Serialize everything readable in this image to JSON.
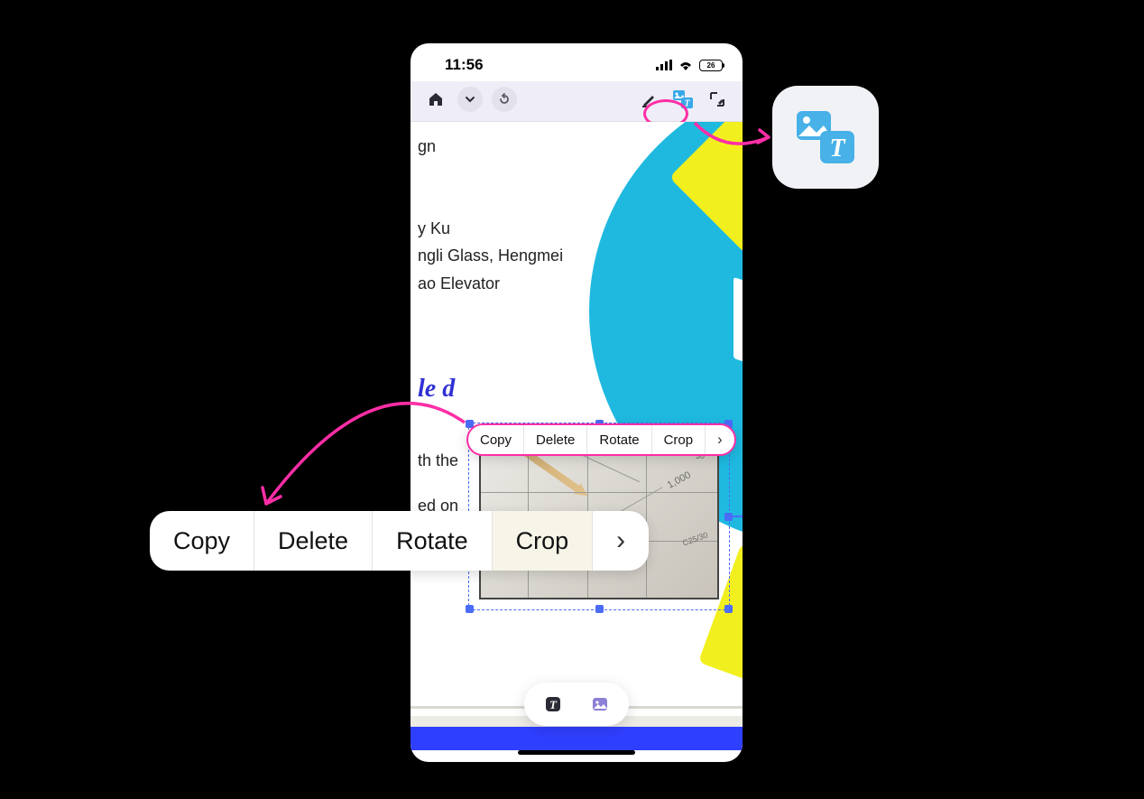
{
  "status_bar": {
    "time": "11:56",
    "battery_level": "26"
  },
  "toolbar": {
    "home_icon": "home-icon",
    "chevron_icon": "chevron-down-icon",
    "redo_icon": "redo-icon",
    "highlighter_icon": "highlighter-icon",
    "image_text_icon": "image-text-tool-icon",
    "crop_select_icon": "crop-select-icon"
  },
  "document": {
    "text_fragments": [
      "gn",
      "y Ku",
      "ngli Glass, Hengmei",
      "ao Elevator"
    ],
    "heading_fragment": "le d",
    "body_fragment_1": "th the",
    "body_fragment_2": "ed on"
  },
  "blueprint_labels": [
    "1,000",
    "C25/30",
    "30"
  ],
  "context_menu_small": {
    "items": [
      "Copy",
      "Delete",
      "Rotate",
      "Crop"
    ],
    "more_icon": "chevron-right-icon"
  },
  "context_menu_large": {
    "items": [
      "Copy",
      "Delete",
      "Rotate",
      "Crop"
    ],
    "more_icon": "chevron-right-icon"
  },
  "bottom_toolbar": {
    "text_mode_icon": "text-mode-icon",
    "image_mode_icon": "image-mode-icon"
  },
  "callout": {
    "icon": "image-text-tool-icon"
  },
  "colors": {
    "annotation_pink": "#ff2ea6",
    "tool_blue": "#38a8e8",
    "heading_blue": "#3030d4",
    "selection_blue": "#4a6cf7"
  }
}
